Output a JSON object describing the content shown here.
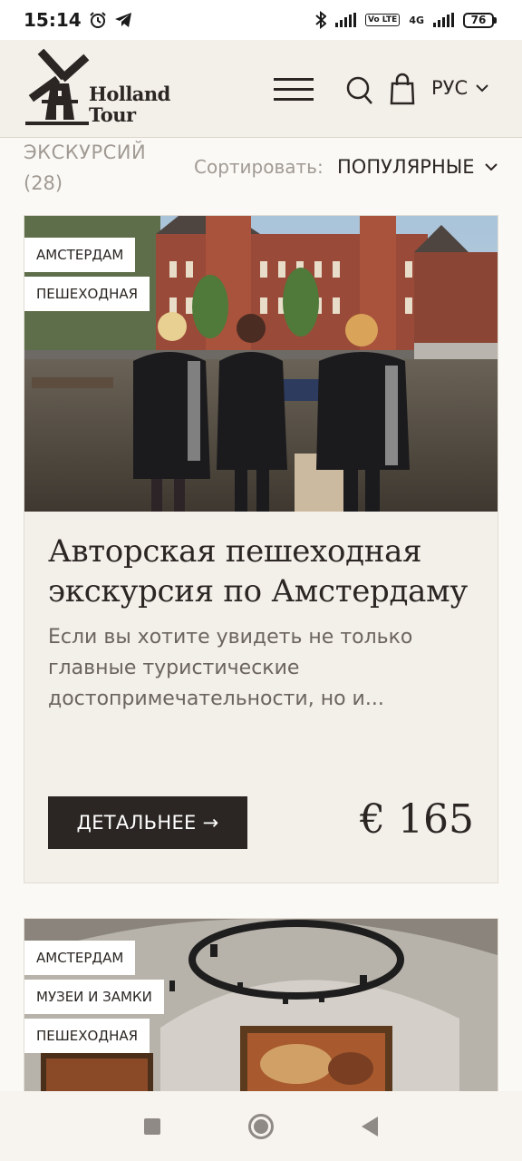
{
  "status_bar": {
    "time": "15:14",
    "network": "4G",
    "volte": "Vo LTE",
    "battery": "76"
  },
  "header": {
    "logo_line1": "Holland",
    "logo_line2": "Tour",
    "language": "РУС"
  },
  "filters": {
    "count_label": "ЭКСКУРСИЙ",
    "count_value": "(28)",
    "sort_label": "Сортировать:",
    "sort_value": "ПОПУЛЯРНЫЕ"
  },
  "tours": [
    {
      "tags": [
        "АМСТЕРДАМ",
        "ПЕШЕХОДНАЯ"
      ],
      "title": "Авторская пешеходная экскурсия по Амстердаму",
      "description": "Если вы хотите увидеть не только главные туристические достопримечательности, но и...",
      "button_label": "ДЕТАЛЬНЕЕ →",
      "price": "€ 165"
    },
    {
      "tags": [
        "АМСТЕРДАМ",
        "МУЗЕИ И ЗАМКИ",
        "ПЕШЕХОДНАЯ"
      ]
    }
  ],
  "colors": {
    "background": "#fbf9f5",
    "header_bg": "#f3efe9",
    "card_bg": "#f3efe9",
    "button_bg": "#2b2623",
    "muted_text": "#a19a94"
  }
}
